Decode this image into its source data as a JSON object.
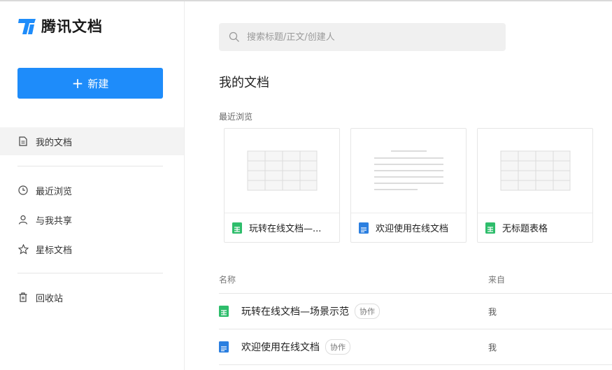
{
  "app": {
    "name": "腾讯文档"
  },
  "sidebar": {
    "new_button": "新建",
    "items": [
      {
        "label": "我的文档",
        "icon": "document-icon",
        "active": true
      },
      {
        "label": "最近浏览",
        "icon": "clock-icon"
      },
      {
        "label": "与我共享",
        "icon": "user-icon"
      },
      {
        "label": "星标文档",
        "icon": "star-icon"
      },
      {
        "label": "回收站",
        "icon": "trash-icon"
      }
    ]
  },
  "search": {
    "placeholder": "搜索标题/正文/创建人",
    "value": ""
  },
  "main": {
    "title": "我的文档",
    "recent_label": "最近浏览",
    "recent": [
      {
        "title": "玩转在线文档—...",
        "type": "sheet"
      },
      {
        "title": "欢迎使用在线文档",
        "type": "doc"
      },
      {
        "title": "无标题表格",
        "type": "sheet"
      }
    ],
    "table": {
      "columns": [
        "名称",
        "来自"
      ],
      "rows": [
        {
          "name": "玩转在线文档—场景示范",
          "badge": "协作",
          "from": "我",
          "type": "sheet"
        },
        {
          "name": "欢迎使用在线文档",
          "badge": "协作",
          "from": "我",
          "type": "doc"
        }
      ]
    }
  },
  "colors": {
    "accent": "#1e8cfa",
    "sheet": "#2ebd6b",
    "doc": "#2b7fe0"
  }
}
